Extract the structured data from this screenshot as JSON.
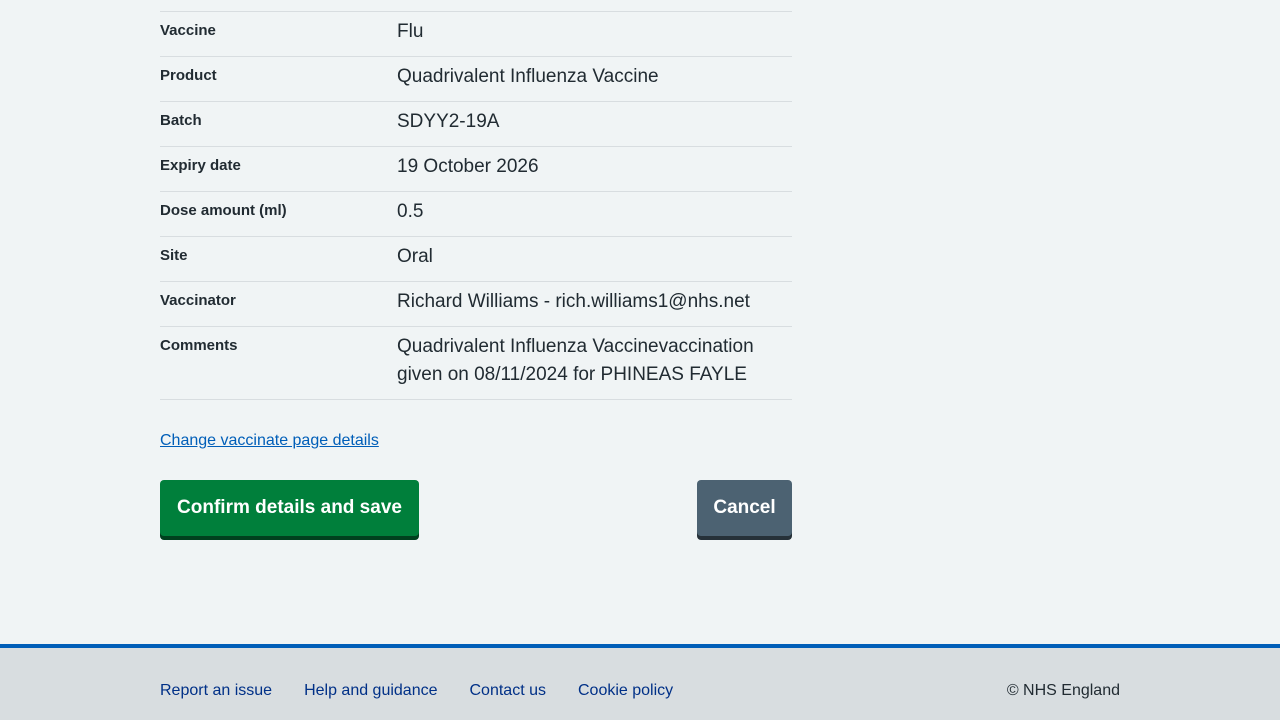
{
  "summary": [
    {
      "key": "Vaccine",
      "value": "Flu"
    },
    {
      "key": "Product",
      "value": "Quadrivalent Influenza Vaccine"
    },
    {
      "key": "Batch",
      "value": "SDYY2-19A"
    },
    {
      "key": "Expiry date",
      "value": "19 October 2026"
    },
    {
      "key": "Dose amount (ml)",
      "value": "0.5"
    },
    {
      "key": "Site",
      "value": "Oral"
    },
    {
      "key": "Vaccinator",
      "value": "Richard Williams - rich.williams1@nhs.net"
    },
    {
      "key": "Comments",
      "value": "Quadrivalent Influenza Vaccinevaccination given on 08/11/2024 for PHINEAS FAYLE"
    }
  ],
  "change_link": "Change vaccinate page details",
  "buttons": {
    "confirm": "Confirm details and save",
    "cancel": "Cancel"
  },
  "footer": {
    "links": [
      "Report an issue",
      "Help and guidance",
      "Contact us",
      "Cookie policy"
    ],
    "copyright": "© NHS England"
  },
  "colors": {
    "background": "#f0f4f5",
    "link": "#005eb8",
    "confirm_button": "#007f3b",
    "cancel_button": "#4c6272",
    "footer_border": "#005eb8"
  }
}
